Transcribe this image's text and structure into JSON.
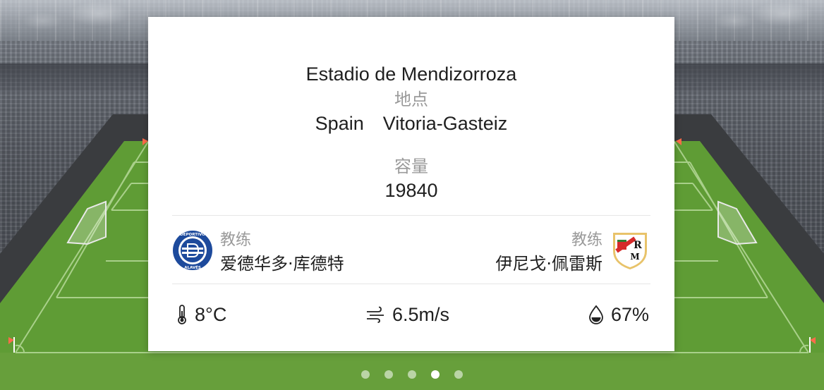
{
  "venue": {
    "name": "Estadio de Mendizorroza",
    "location_label": "地点",
    "location_value": "Spain  Vitoria-Gasteiz",
    "capacity_label": "容量",
    "capacity_value": "19840"
  },
  "coaches": {
    "home": {
      "label": "教练",
      "name": "爱德华多·库德特",
      "crest_icon": "alaves-crest-icon",
      "crest_text": "DEPORTIVO ALAVÉS"
    },
    "away": {
      "label": "教练",
      "name": "伊尼戈·佩雷斯",
      "crest_icon": "rayo-vallecano-crest-icon",
      "crest_text": "R M"
    }
  },
  "weather": {
    "temperature": "8°C",
    "wind": "6.5m/s",
    "humidity": "67%"
  },
  "pager": {
    "count": 5,
    "active_index": 3
  },
  "colors": {
    "pitch_green": "#5f9c35",
    "stand_dark": "#3a3c3f",
    "card_bg": "#ffffff",
    "alaves_blue": "#1d4a9c",
    "rayo_red": "#d62a2a"
  }
}
